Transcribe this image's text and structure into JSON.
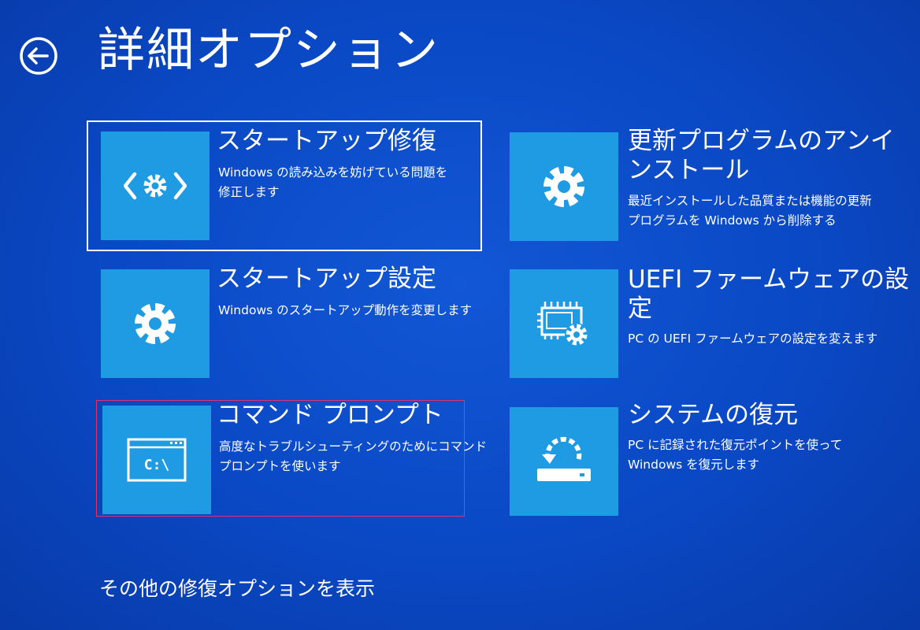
{
  "header": {
    "title": "詳細オプション",
    "back_icon": "back-arrow-icon"
  },
  "options": [
    {
      "title": "スタートアップ修復",
      "desc_lines": [
        "Windows の読み込みを妨げている問題を",
        "修正します"
      ],
      "icon": "startup-repair-icon",
      "state": "focused"
    },
    {
      "title_lines": [
        "更新プログラムのアンイ",
        "ンストール"
      ],
      "desc_lines": [
        "最近インストールした品質または機能の更新",
        "プログラムを Windows から削除する"
      ],
      "icon": "gear-icon"
    },
    {
      "title": "スタートアップ設定",
      "desc_lines": [
        "Windows のスタートアップ動作を変更します"
      ],
      "icon": "gear-icon"
    },
    {
      "title_lines": [
        "UEFI ファームウェアの設",
        "定"
      ],
      "desc_lines": [
        "PC の UEFI ファームウェアの設定を変えます"
      ],
      "icon": "firmware-chip-gear-icon"
    },
    {
      "title": "コマンド プロンプト",
      "desc_lines": [
        "高度なトラブルシューティングのためにコマンド",
        "プロンプトを使います"
      ],
      "icon": "command-prompt-icon",
      "icon_text": "C:\\",
      "state": "highlighted"
    },
    {
      "title": "システムの復元",
      "desc_lines": [
        "PC に記録された復元ポイントを使って",
        "Windows を復元します"
      ],
      "icon": "system-restore-icon"
    }
  ],
  "footer": {
    "more_options": "その他の修復オプションを表示"
  },
  "colors": {
    "background": "#0a48c4",
    "tile": "#1f9be4",
    "focus_border": "#ffffff",
    "highlight_border": "#e0326e"
  }
}
